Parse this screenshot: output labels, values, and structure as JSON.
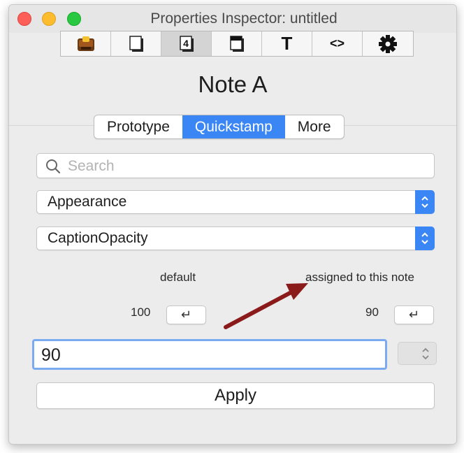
{
  "window": {
    "title": "Properties Inspector: untitled"
  },
  "toolbar": {
    "tabs": [
      {
        "icon": "document-bundle-icon"
      },
      {
        "icon": "note-page-icon"
      },
      {
        "icon": "number-4-icon"
      },
      {
        "icon": "shadow-box-icon"
      },
      {
        "icon": "text-T-icon",
        "glyph": "T"
      },
      {
        "icon": "code-brackets-icon",
        "glyph": "<>"
      },
      {
        "icon": "gear-icon"
      }
    ],
    "active_index": 2
  },
  "note": {
    "title": "Note A"
  },
  "segmented": {
    "tabs": [
      "Prototype",
      "Quickstamp",
      "More"
    ],
    "selected": "Quickstamp"
  },
  "search": {
    "placeholder": "Search"
  },
  "category_popup": {
    "value": "Appearance"
  },
  "attribute_popup": {
    "value": "CaptionOpacity"
  },
  "columns": {
    "default_label": "default",
    "assigned_label": "assigned to this note",
    "default_value": "100",
    "assigned_value": "90",
    "copy_glyph": "↵"
  },
  "value_input": {
    "value": "90"
  },
  "apply": {
    "label": "Apply"
  },
  "colors": {
    "accent": "#3a86f5",
    "arrow": "#8b1a1a"
  }
}
